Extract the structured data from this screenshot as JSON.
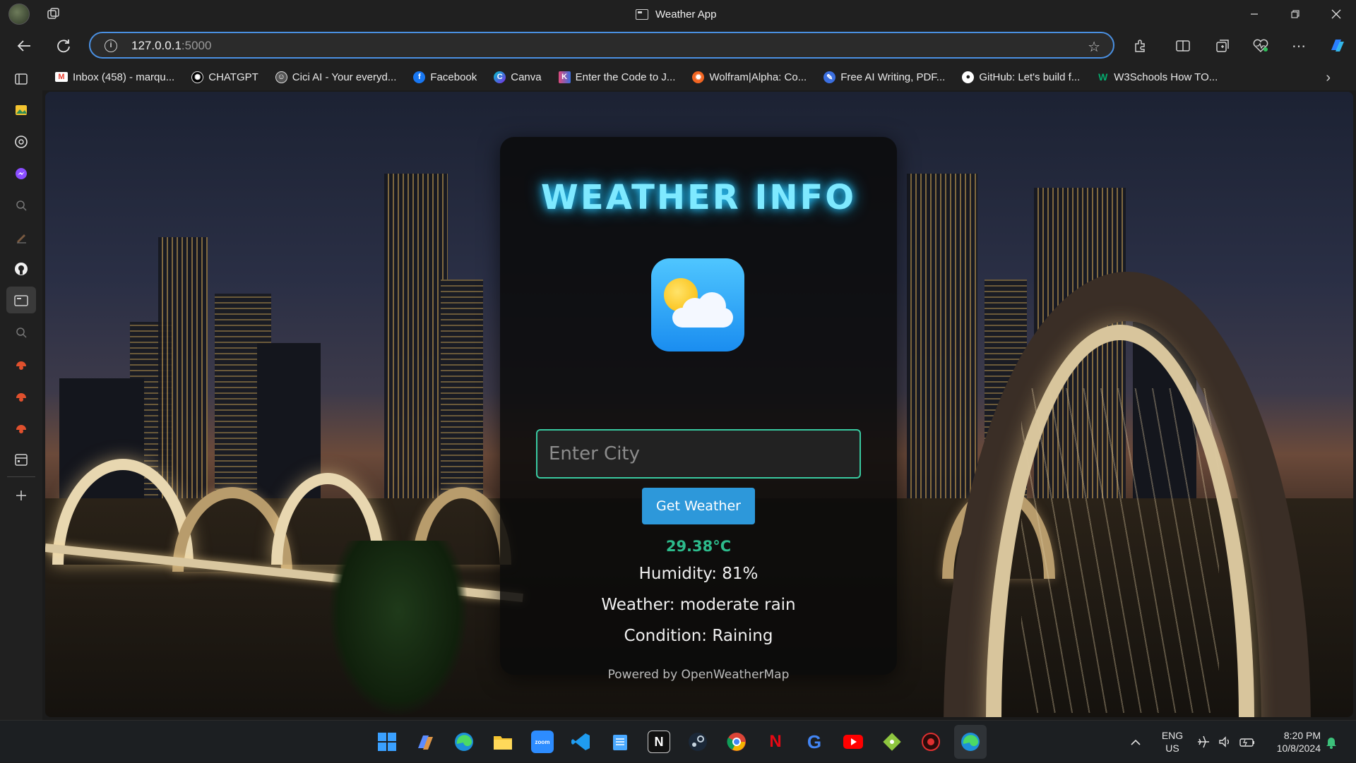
{
  "window": {
    "title": "Weather App"
  },
  "address_bar": {
    "url_host": "127.0.0.1",
    "url_port": ":5000"
  },
  "favorites": [
    {
      "label": "Inbox (458) - marqu...",
      "icon": "gmail-icon",
      "color": "#ea4335"
    },
    {
      "label": "CHATGPT",
      "icon": "chatgpt-icon",
      "color": "#444444"
    },
    {
      "label": "Cici AI - Your everyd...",
      "icon": "cici-icon",
      "color": "#6b6b6b"
    },
    {
      "label": "Facebook",
      "icon": "facebook-icon",
      "color": "#1877f2"
    },
    {
      "label": "Canva",
      "icon": "canva-icon",
      "color": "#00c4cc"
    },
    {
      "label": "Enter the Code to J...",
      "icon": "kahoot-icon",
      "color": "#e04a7c"
    },
    {
      "label": "Wolfram|Alpha: Co...",
      "icon": "wolfram-icon",
      "color": "#f26522"
    },
    {
      "label": "Free AI Writing, PDF...",
      "icon": "ai-writing-icon",
      "color": "#3b6fe0"
    },
    {
      "label": "GitHub: Let's build f...",
      "icon": "github-icon",
      "color": "#333333"
    },
    {
      "label": "W3Schools How TO...",
      "icon": "w3schools-icon",
      "color": "#04aa6d"
    }
  ],
  "card": {
    "title": "WEATHER INFO",
    "input_placeholder": "Enter City",
    "button_label": "Get Weather",
    "temperature": "29.38°C",
    "humidity": "Humidity: 81%",
    "weather": "Weather: moderate rain",
    "condition": "Condition: Raining",
    "powered_by": "Powered by OpenWeatherMap",
    "accent_color": "#7ee9ff",
    "temp_color": "#2dbb8c",
    "button_color": "#2d98da",
    "input_border_color": "#39c9a0"
  },
  "taskbar": {
    "apps": [
      "start-icon",
      "copilot-icon",
      "edge-icon",
      "file-explorer-icon",
      "zoom-icon",
      "vscode-icon",
      "notepad-icon",
      "notion-icon",
      "steam-icon",
      "chrome-icon",
      "netflix-icon",
      "google-icon",
      "youtube-icon",
      "git-icon",
      "red-app-icon",
      "edge-dev-icon"
    ],
    "zoom_label": "zoom",
    "lang_line1": "ENG",
    "lang_line2": "US",
    "time": "8:20 PM",
    "date": "10/8/2024"
  }
}
